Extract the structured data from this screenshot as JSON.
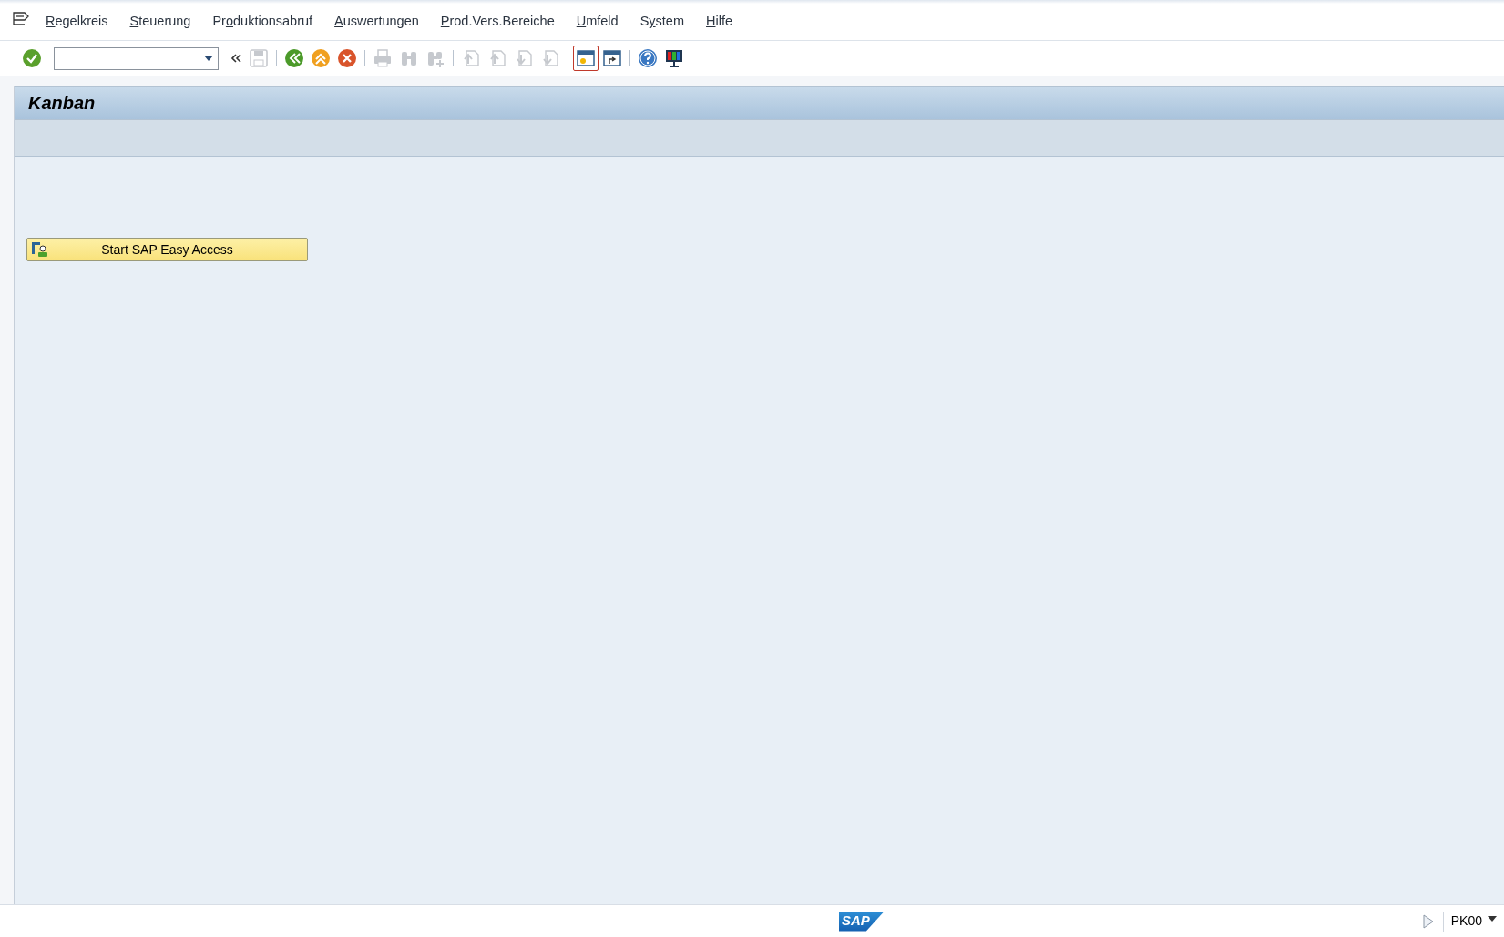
{
  "menu": [
    {
      "key": "R",
      "post": "egelkreis"
    },
    {
      "key": "S",
      "post": "teuerung"
    },
    {
      "pre": "Pr",
      "key": "o",
      "post": "duktionsabruf"
    },
    {
      "key": "A",
      "post": "uswertungen"
    },
    {
      "key": "P",
      "post": "rod.Vers.Bereiche"
    },
    {
      "key": "U",
      "post": "mfeld"
    },
    {
      "pre": "S",
      "key": "y",
      "post": "stem"
    },
    {
      "key": "H",
      "post": "ilfe"
    }
  ],
  "toolbar": [
    {
      "kind": "back_arrows",
      "disabled": false,
      "selected": false
    },
    {
      "kind": "save",
      "disabled": true,
      "selected": false
    },
    {
      "kind": "sep"
    },
    {
      "kind": "back",
      "disabled": false,
      "selected": false
    },
    {
      "kind": "exit",
      "disabled": false,
      "selected": false
    },
    {
      "kind": "cancel",
      "disabled": false,
      "selected": false
    },
    {
      "kind": "sep"
    },
    {
      "kind": "print",
      "disabled": true,
      "selected": false
    },
    {
      "kind": "find",
      "disabled": true,
      "selected": false
    },
    {
      "kind": "find_next",
      "disabled": true,
      "selected": false
    },
    {
      "kind": "sep"
    },
    {
      "kind": "first_page",
      "disabled": true,
      "selected": false
    },
    {
      "kind": "prev_page",
      "disabled": true,
      "selected": false
    },
    {
      "kind": "next_page",
      "disabled": true,
      "selected": false
    },
    {
      "kind": "last_page",
      "disabled": true,
      "selected": false
    },
    {
      "kind": "sep"
    },
    {
      "kind": "new_session",
      "disabled": false,
      "selected": true
    },
    {
      "kind": "shortcut",
      "disabled": false,
      "selected": false
    },
    {
      "kind": "sep"
    },
    {
      "kind": "help",
      "disabled": false,
      "selected": false
    },
    {
      "kind": "layout",
      "disabled": false,
      "selected": false
    }
  ],
  "title": "Kanban",
  "buttons": [
    {
      "label": "Start SAP Easy Access"
    }
  ],
  "status_bar": {
    "logo_text": "SAP",
    "transaction": "PK00"
  }
}
